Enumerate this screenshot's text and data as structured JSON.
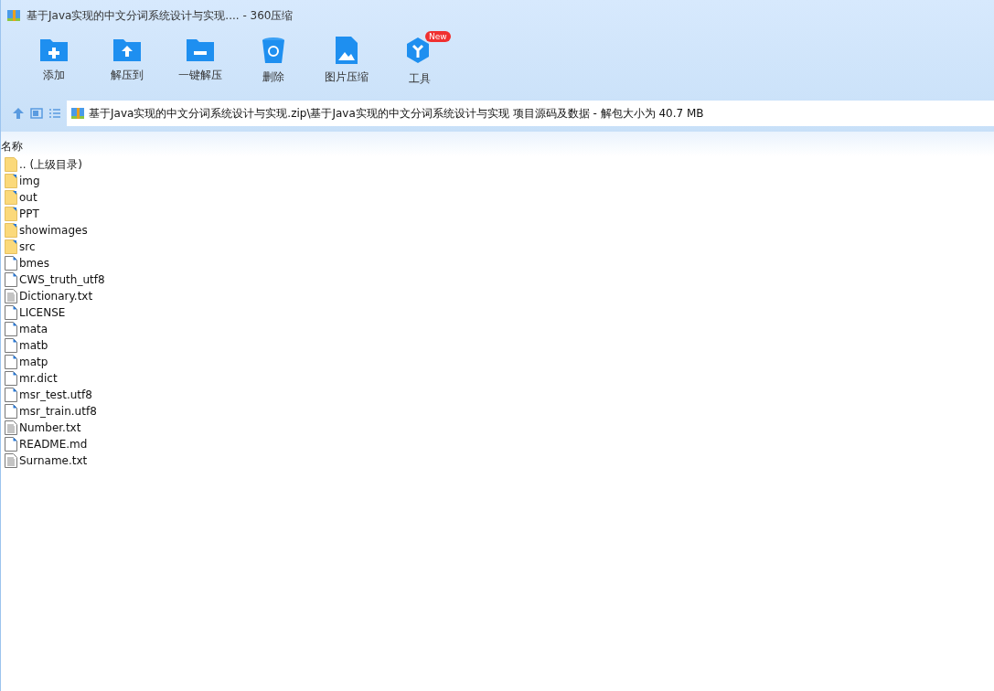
{
  "window": {
    "title": "基于Java实现的中文分词系统设计与实现.... - 360压缩"
  },
  "toolbar": [
    {
      "kind": "add",
      "label": "添加"
    },
    {
      "kind": "extract",
      "label": "解压到"
    },
    {
      "kind": "quick",
      "label": "一键解压"
    },
    {
      "kind": "delete",
      "label": "删除"
    },
    {
      "kind": "image",
      "label": "图片压缩"
    },
    {
      "kind": "tools",
      "label": "工具",
      "badge": "New"
    }
  ],
  "address": {
    "path": "基于Java实现的中文分词系统设计与实现.zip\\基于Java实现的中文分词系统设计与实现 项目源码及数据 - 解包大小为 40.7 MB"
  },
  "table": {
    "columns": [
      "名称"
    ],
    "rows": [
      {
        "kind": "parent",
        "name": ".. (上级目录)"
      },
      {
        "kind": "folder",
        "name": "img"
      },
      {
        "kind": "folder",
        "name": "out"
      },
      {
        "kind": "folder",
        "name": "PPT"
      },
      {
        "kind": "folder",
        "name": "showimages"
      },
      {
        "kind": "folder",
        "name": "src"
      },
      {
        "kind": "file",
        "name": "bmes"
      },
      {
        "kind": "file",
        "name": "CWS_truth_utf8"
      },
      {
        "kind": "text",
        "name": "Dictionary.txt"
      },
      {
        "kind": "file",
        "name": "LICENSE"
      },
      {
        "kind": "file",
        "name": "mata"
      },
      {
        "kind": "file",
        "name": "matb"
      },
      {
        "kind": "file",
        "name": "matp"
      },
      {
        "kind": "file",
        "name": "mr.dict"
      },
      {
        "kind": "file",
        "name": "msr_test.utf8"
      },
      {
        "kind": "file",
        "name": "msr_train.utf8"
      },
      {
        "kind": "text",
        "name": "Number.txt"
      },
      {
        "kind": "file",
        "name": "README.md"
      },
      {
        "kind": "text",
        "name": "Surname.txt"
      }
    ]
  }
}
